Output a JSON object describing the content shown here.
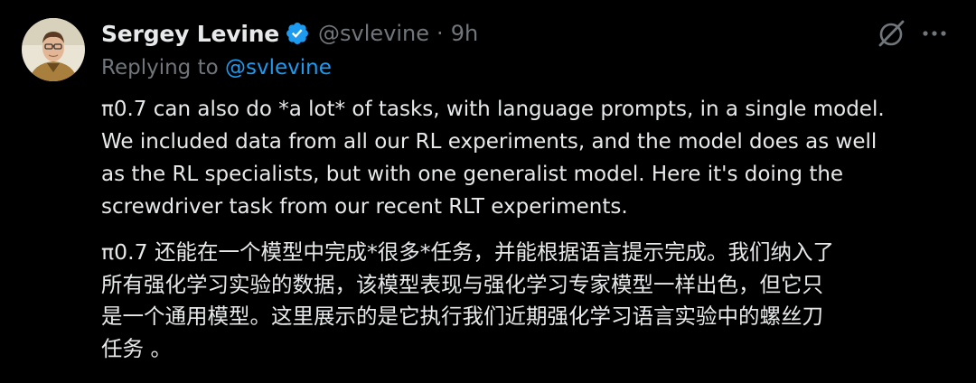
{
  "author": {
    "display_name": "Sergey Levine",
    "handle": "@svlevine",
    "separator": "·",
    "time": "9h",
    "verified": true
  },
  "reply": {
    "prefix": "Replying to ",
    "mention": "@svlevine"
  },
  "body_en": {
    "lines": [
      "π0.7 can also do *a lot* of tasks, with language prompts, in a single model.",
      "We included data from all our RL experiments, and the model does as well",
      "as the RL specialists, but with one generalist model. Here it's doing the",
      "screwdriver task from our recent RLT experiments."
    ]
  },
  "body_zh": {
    "lines": [
      "π0.7 还能在一个模型中完成*很多*任务，并能根据语言提示完成。我们纳入了",
      "所有强化学习实验的数据，该模型表现与强化学习专家模型一样出色，但它只",
      "是一个通用模型。这里展示的是它执行我们近期强化学习语言实验中的螺丝刀",
      "任务 。"
    ]
  },
  "icons": {
    "verified": "verified-badge-icon",
    "grok": "grok-icon",
    "more": "more-horizontal-icon"
  },
  "colors": {
    "background": "#000000",
    "text_primary": "#e7e9ea",
    "text_secondary": "#71767b",
    "accent": "#1d9bf0"
  }
}
